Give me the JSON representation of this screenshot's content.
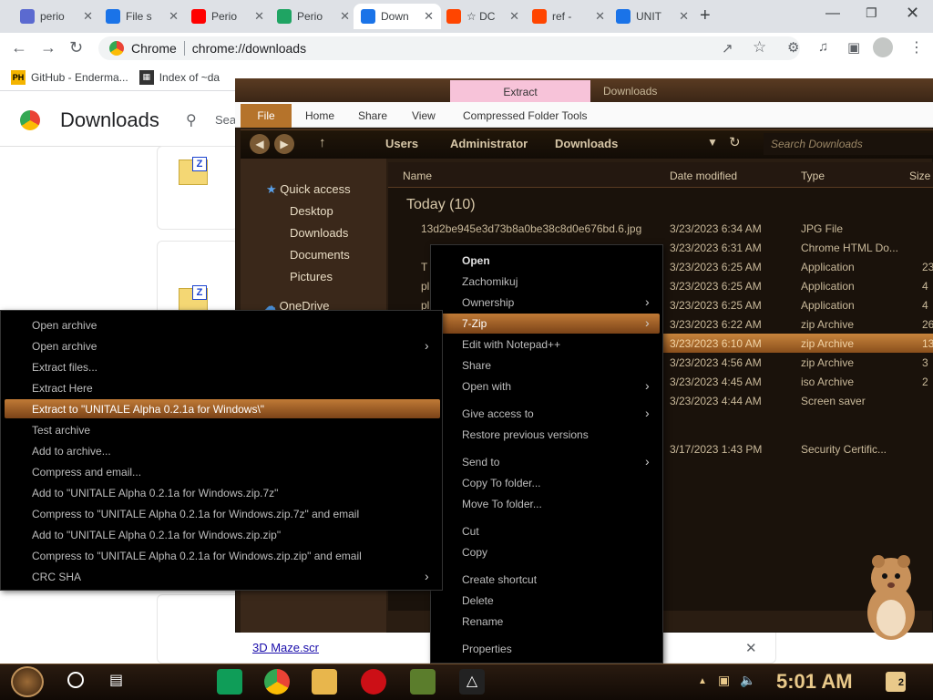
{
  "browser": {
    "tabs": [
      {
        "label": "perio",
        "favicon": "MT",
        "color": "#5b6ad0"
      },
      {
        "label": "File s",
        "favicon": "edge",
        "color": "#1a73e8"
      },
      {
        "label": "Perio",
        "favicon": "youtube",
        "color": "#ff0000"
      },
      {
        "label": "Perio",
        "favicon": "drive",
        "color": "#1fa463"
      },
      {
        "label": "Down",
        "favicon": "download",
        "color": "#1a73e8"
      },
      {
        "label": "☆ DC",
        "favicon": "reddit",
        "color": "#ff4500"
      },
      {
        "label": "ref -",
        "favicon": "reddit",
        "color": "#ff4500"
      },
      {
        "label": "UNIT",
        "favicon": "edge",
        "color": "#1a73e8"
      }
    ],
    "omnibox": {
      "site_label": "Chrome",
      "url": "chrome://downloads"
    },
    "bookmarks": [
      {
        "label": "GitHub - Enderma...",
        "icon": "PH"
      },
      {
        "label": "Index of ~da",
        "icon": "index"
      }
    ]
  },
  "downloads_page": {
    "title": "Downloads",
    "search_placeholder": "Sea",
    "file_link": "3D Maze.scr"
  },
  "explorer": {
    "ribbon_context_tab": "Extract",
    "ribbon_context_sub": "Downloads",
    "ribbon_tabs": [
      "File",
      "Home",
      "Share",
      "View",
      "Compressed Folder Tools"
    ],
    "breadcrumb": [
      "Users",
      "Administrator",
      "Downloads"
    ],
    "search_placeholder": "Search Downloads",
    "nav": [
      "Quick access",
      "Desktop",
      "Downloads",
      "Documents",
      "Pictures",
      "OneDrive"
    ],
    "columns": [
      "Name",
      "Date modified",
      "Type",
      "Size"
    ],
    "group_label": "Today (10)",
    "rows": [
      {
        "name": "13d2be945e3d73b8a0be38c8d0e676bd.6.jpg",
        "date": "3/23/2023 6:34 AM",
        "type": "JPG File",
        "size": ""
      },
      {
        "name": "",
        "date": "3/23/2023 6:31 AM",
        "type": "Chrome HTML Do...",
        "size": ""
      },
      {
        "name": "T",
        "date": "3/23/2023 6:25 AM",
        "type": "Application",
        "size": "23"
      },
      {
        "name": "pl",
        "date": "3/23/2023 6:25 AM",
        "type": "Application",
        "size": "4"
      },
      {
        "name": "pl",
        "date": "3/23/2023 6:25 AM",
        "type": "Application",
        "size": "4"
      },
      {
        "name": "",
        "date": "3/23/2023 6:22 AM",
        "type": "zip Archive",
        "size": "26"
      },
      {
        "name": "",
        "date": "3/23/2023 6:10 AM",
        "type": "zip Archive",
        "size": "13"
      },
      {
        "name": "",
        "date": "3/23/2023 4:56 AM",
        "type": "zip Archive",
        "size": "3"
      },
      {
        "name": "",
        "date": "3/23/2023 4:45 AM",
        "type": "iso Archive",
        "size": "2"
      },
      {
        "name": "",
        "date": "3/23/2023 4:44 AM",
        "type": "Screen saver",
        "size": ""
      },
      {
        "name": "",
        "date": "3/17/2023 1:43 PM",
        "type": "Security Certific...",
        "size": ""
      }
    ]
  },
  "context_menu": [
    {
      "label": "Open",
      "bold": true
    },
    {
      "label": "Zachomikuj"
    },
    {
      "label": "Ownership",
      "submenu": true
    },
    {
      "label": "7-Zip",
      "submenu": true,
      "highlighted": true
    },
    {
      "label": "Edit with Notepad++"
    },
    {
      "label": "Share"
    },
    {
      "label": "Open with",
      "submenu": true
    },
    {
      "label": "Give access to",
      "submenu": true
    },
    {
      "label": "Restore previous versions"
    },
    {
      "label": "Send to",
      "submenu": true
    },
    {
      "label": "Copy To folder..."
    },
    {
      "label": "Move To folder..."
    },
    {
      "label": "Cut"
    },
    {
      "label": "Copy"
    },
    {
      "label": "Create shortcut"
    },
    {
      "label": "Delete"
    },
    {
      "label": "Rename"
    },
    {
      "label": "Properties"
    }
  ],
  "zip_submenu": [
    {
      "label": "Open archive"
    },
    {
      "label": "Open archive",
      "submenu": true
    },
    {
      "label": "Extract files..."
    },
    {
      "label": "Extract Here"
    },
    {
      "label": "Extract to \"UNITALE Alpha 0.2.1a for Windows\\\"",
      "highlighted": true
    },
    {
      "label": "Test archive"
    },
    {
      "label": "Add to archive..."
    },
    {
      "label": "Compress and email..."
    },
    {
      "label": "Add to \"UNITALE Alpha 0.2.1a for Windows.zip.7z\""
    },
    {
      "label": "Compress to \"UNITALE Alpha 0.2.1a for Windows.zip.7z\" and email"
    },
    {
      "label": "Add to \"UNITALE Alpha 0.2.1a for Windows.zip.zip\""
    },
    {
      "label": "Compress to \"UNITALE Alpha 0.2.1a for Windows.zip.zip\" and email"
    },
    {
      "label": "CRC SHA",
      "submenu": true
    }
  ],
  "taskbar": {
    "clock": "5:01 AM",
    "notification_count": "2"
  },
  "colors": {
    "accent": "#b5732b",
    "highlight": "#c07a36",
    "menu_bg": "#000000"
  }
}
